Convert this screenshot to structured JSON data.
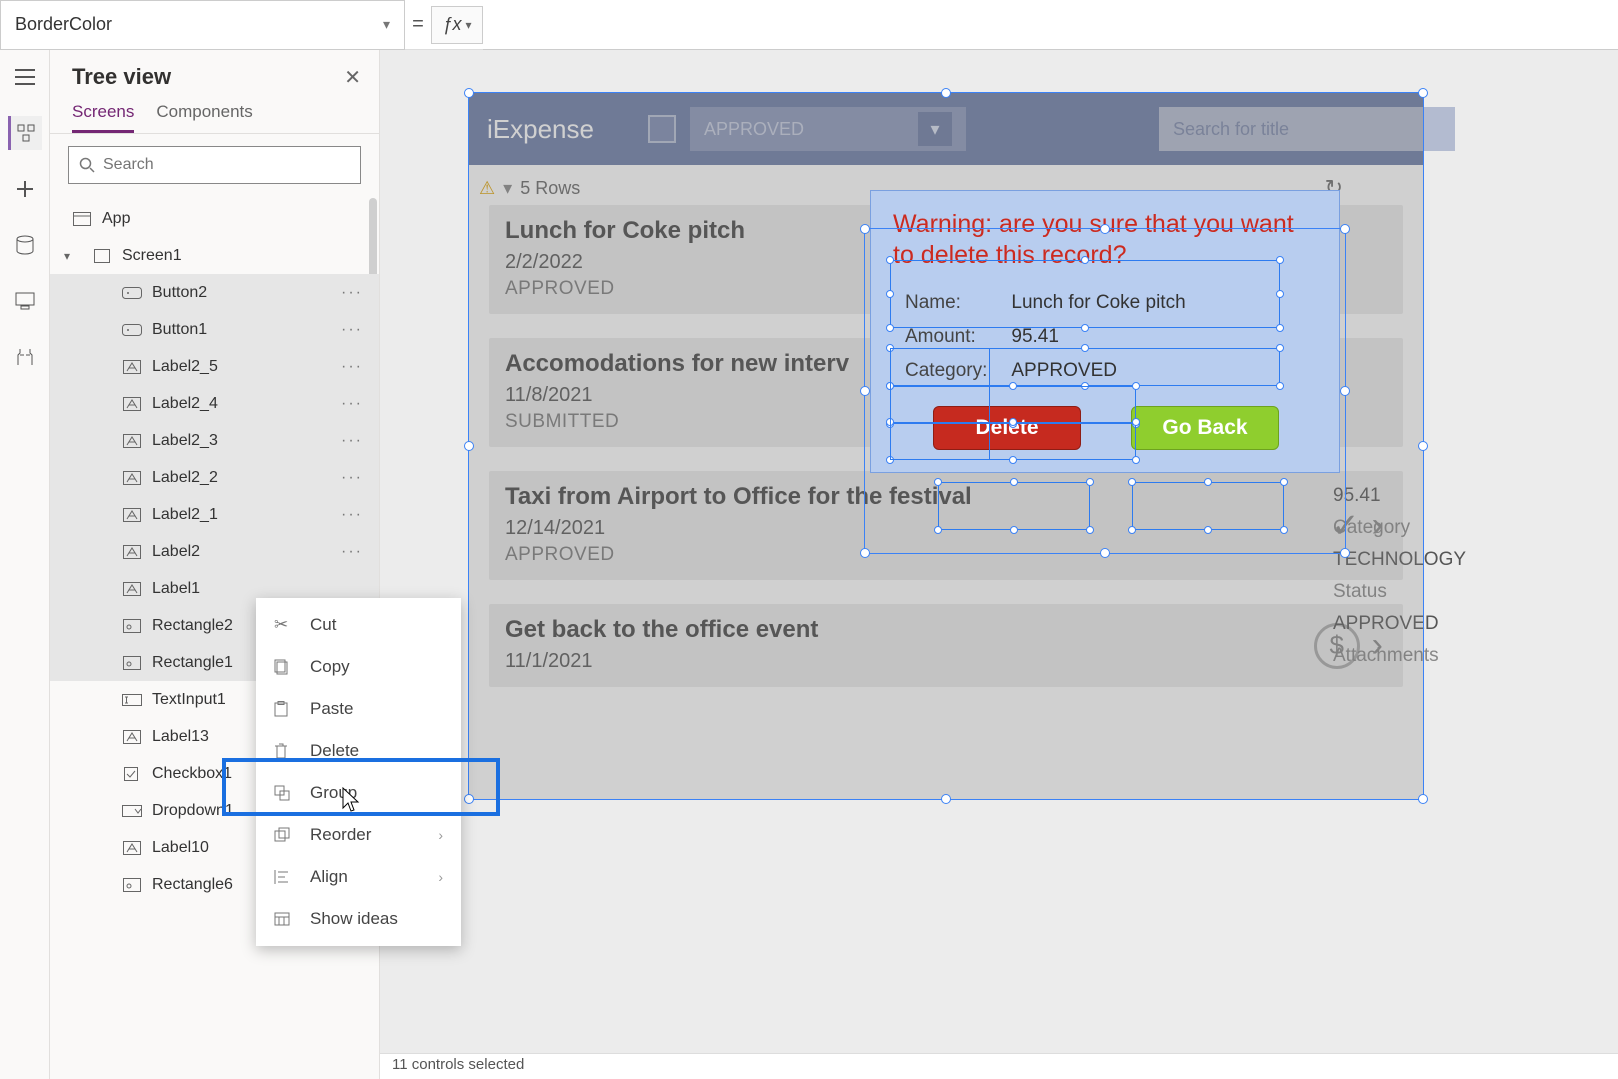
{
  "formula": {
    "property": "BorderColor",
    "value": ""
  },
  "tree_panel": {
    "title": "Tree view",
    "tabs": {
      "screens": "Screens",
      "components": "Components"
    },
    "search_placeholder": "Search",
    "app_label": "App",
    "screen_label": "Screen1",
    "items": [
      {
        "icon": "button",
        "label": "Button2"
      },
      {
        "icon": "button",
        "label": "Button1"
      },
      {
        "icon": "label",
        "label": "Label2_5"
      },
      {
        "icon": "label",
        "label": "Label2_4"
      },
      {
        "icon": "label",
        "label": "Label2_3"
      },
      {
        "icon": "label",
        "label": "Label2_2"
      },
      {
        "icon": "label",
        "label": "Label2_1"
      },
      {
        "icon": "label",
        "label": "Label2"
      },
      {
        "icon": "label",
        "label": "Label1"
      },
      {
        "icon": "rect",
        "label": "Rectangle2"
      },
      {
        "icon": "rect",
        "label": "Rectangle1"
      },
      {
        "icon": "textinput",
        "label": "TextInput1"
      },
      {
        "icon": "label",
        "label": "Label13"
      },
      {
        "icon": "checkbox",
        "label": "Checkbox1"
      },
      {
        "icon": "dropdown",
        "label": "Dropdown1"
      },
      {
        "icon": "label",
        "label": "Label10"
      },
      {
        "icon": "rect",
        "label": "Rectangle6"
      }
    ]
  },
  "context_menu": {
    "cut": "Cut",
    "copy": "Copy",
    "paste": "Paste",
    "delete": "Delete",
    "group": "Group",
    "reorder": "Reorder",
    "align": "Align",
    "show_ideas": "Show ideas"
  },
  "app": {
    "title": "iExpense",
    "filter_value": "APPROVED",
    "search_placeholder": "Search for title",
    "row_count": "5 Rows",
    "cards": [
      {
        "title": "Lunch for Coke pitch",
        "date": "2/2/2022",
        "status": "APPROVED"
      },
      {
        "title": "Accomodations for new interv",
        "date": "11/8/2021",
        "status": "SUBMITTED"
      },
      {
        "title": "Taxi from Airport to Office for the festival",
        "date": "12/14/2021",
        "status": "APPROVED"
      },
      {
        "title": "Get back to the office event",
        "date": "11/1/2021",
        "status": ""
      }
    ],
    "detail": {
      "amount_value": "95.41",
      "category_label": "Category",
      "category_value": "TECHNOLOGY",
      "status_label": "Status",
      "status_value": "APPROVED",
      "attachments_label": "Attachments"
    }
  },
  "dialog": {
    "warning": "Warning: are you sure that you want to delete this record?",
    "name_label": "Name:",
    "name_value": "Lunch for Coke pitch",
    "amount_label": "Amount:",
    "amount_value": "95.41",
    "category_label": "Category:",
    "category_value": "APPROVED",
    "delete": "Delete",
    "goback": "Go Back"
  },
  "status_text": "11 controls selected"
}
